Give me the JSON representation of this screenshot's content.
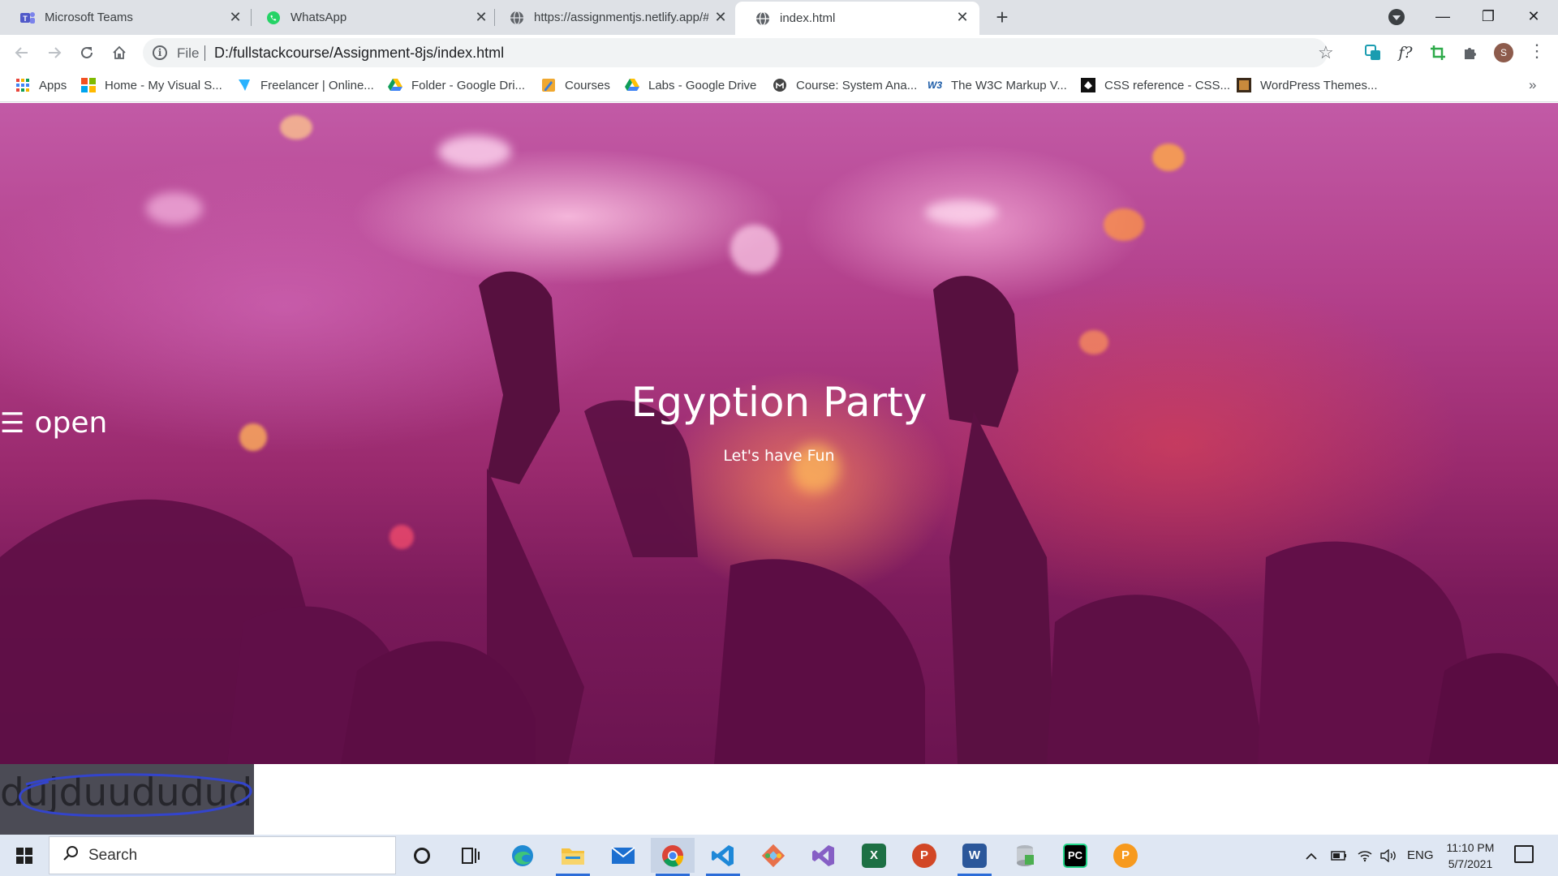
{
  "tabs": [
    {
      "title": "Microsoft Teams",
      "icon": "teams-icon"
    },
    {
      "title": "WhatsApp",
      "icon": "whatsapp-icon"
    },
    {
      "title": "https://assignmentjs.netlify.app/#",
      "icon": "globe-icon"
    },
    {
      "title": "index.html",
      "icon": "globe-icon",
      "active": true
    }
  ],
  "window_controls": {
    "minimize": "—",
    "restore": "❐",
    "close": "✕"
  },
  "address_bar": {
    "scheme_label": "File",
    "url": "D:/fullstackcourse/Assignment-8js/index.html"
  },
  "profile": {
    "initial": "S"
  },
  "bookmarks": [
    {
      "label": "Apps",
      "icon": "apps-grid-icon"
    },
    {
      "label": "Home - My Visual S...",
      "icon": "microsoft-icon"
    },
    {
      "label": "Freelancer | Online...",
      "icon": "freelancer-icon"
    },
    {
      "label": "Folder - Google Dri...",
      "icon": "google-drive-icon"
    },
    {
      "label": "Courses",
      "icon": "courses-icon"
    },
    {
      "label": "Labs - Google Drive",
      "icon": "google-drive-icon"
    },
    {
      "label": "Course: System Ana...",
      "icon": "moodle-icon"
    },
    {
      "label": "The W3C Markup V...",
      "icon": "w3c-icon"
    },
    {
      "label": "CSS reference - CSS...",
      "icon": "css-reference-icon"
    },
    {
      "label": "WordPress Themes...",
      "icon": "wordpress-themes-icon"
    }
  ],
  "page": {
    "menu_glyph": "☰",
    "menu_label": "open",
    "hero_title": "Egyption Party",
    "hero_subtitle": "Let's have Fun",
    "scribble_text": "dujduududud"
  },
  "taskbar": {
    "search_placeholder": "Search",
    "apps": [
      "cortana",
      "task-view",
      "edge",
      "file-explorer",
      "mail",
      "chrome",
      "vscode",
      "git",
      "visual-studio",
      "excel",
      "powerpoint",
      "word",
      "database-tool",
      "pycharm",
      "postman"
    ],
    "language": "ENG",
    "time": "11:10 PM",
    "date": "5/7/2021"
  },
  "colors": {
    "tab_strip": "#dee1e6",
    "hero_overlay": "#9a2a6e",
    "taskbar": "#dfe7f3",
    "scribble_box": "#4b4b55",
    "scribble_stroke": "#3344cc"
  }
}
